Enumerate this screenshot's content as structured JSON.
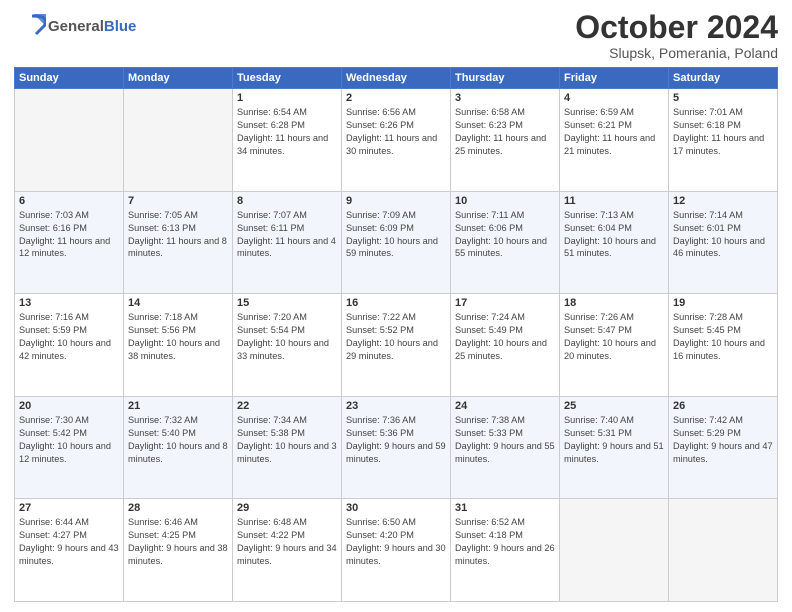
{
  "header": {
    "logo_general": "General",
    "logo_blue": "Blue",
    "month_title": "October 2024",
    "subtitle": "Slupsk, Pomerania, Poland"
  },
  "calendar": {
    "days_of_week": [
      "Sunday",
      "Monday",
      "Tuesday",
      "Wednesday",
      "Thursday",
      "Friday",
      "Saturday"
    ],
    "weeks": [
      {
        "cells": [
          {
            "day": "",
            "empty": true
          },
          {
            "day": "",
            "empty": true
          },
          {
            "day": "1",
            "sunrise": "6:54 AM",
            "sunset": "6:28 PM",
            "daylight": "11 hours and 34 minutes."
          },
          {
            "day": "2",
            "sunrise": "6:56 AM",
            "sunset": "6:26 PM",
            "daylight": "11 hours and 30 minutes."
          },
          {
            "day": "3",
            "sunrise": "6:58 AM",
            "sunset": "6:23 PM",
            "daylight": "11 hours and 25 minutes."
          },
          {
            "day": "4",
            "sunrise": "6:59 AM",
            "sunset": "6:21 PM",
            "daylight": "11 hours and 21 minutes."
          },
          {
            "day": "5",
            "sunrise": "7:01 AM",
            "sunset": "6:18 PM",
            "daylight": "11 hours and 17 minutes."
          }
        ]
      },
      {
        "cells": [
          {
            "day": "6",
            "sunrise": "7:03 AM",
            "sunset": "6:16 PM",
            "daylight": "11 hours and 12 minutes."
          },
          {
            "day": "7",
            "sunrise": "7:05 AM",
            "sunset": "6:13 PM",
            "daylight": "11 hours and 8 minutes."
          },
          {
            "day": "8",
            "sunrise": "7:07 AM",
            "sunset": "6:11 PM",
            "daylight": "11 hours and 4 minutes."
          },
          {
            "day": "9",
            "sunrise": "7:09 AM",
            "sunset": "6:09 PM",
            "daylight": "10 hours and 59 minutes."
          },
          {
            "day": "10",
            "sunrise": "7:11 AM",
            "sunset": "6:06 PM",
            "daylight": "10 hours and 55 minutes."
          },
          {
            "day": "11",
            "sunrise": "7:13 AM",
            "sunset": "6:04 PM",
            "daylight": "10 hours and 51 minutes."
          },
          {
            "day": "12",
            "sunrise": "7:14 AM",
            "sunset": "6:01 PM",
            "daylight": "10 hours and 46 minutes."
          }
        ]
      },
      {
        "cells": [
          {
            "day": "13",
            "sunrise": "7:16 AM",
            "sunset": "5:59 PM",
            "daylight": "10 hours and 42 minutes."
          },
          {
            "day": "14",
            "sunrise": "7:18 AM",
            "sunset": "5:56 PM",
            "daylight": "10 hours and 38 minutes."
          },
          {
            "day": "15",
            "sunrise": "7:20 AM",
            "sunset": "5:54 PM",
            "daylight": "10 hours and 33 minutes."
          },
          {
            "day": "16",
            "sunrise": "7:22 AM",
            "sunset": "5:52 PM",
            "daylight": "10 hours and 29 minutes."
          },
          {
            "day": "17",
            "sunrise": "7:24 AM",
            "sunset": "5:49 PM",
            "daylight": "10 hours and 25 minutes."
          },
          {
            "day": "18",
            "sunrise": "7:26 AM",
            "sunset": "5:47 PM",
            "daylight": "10 hours and 20 minutes."
          },
          {
            "day": "19",
            "sunrise": "7:28 AM",
            "sunset": "5:45 PM",
            "daylight": "10 hours and 16 minutes."
          }
        ]
      },
      {
        "cells": [
          {
            "day": "20",
            "sunrise": "7:30 AM",
            "sunset": "5:42 PM",
            "daylight": "10 hours and 12 minutes."
          },
          {
            "day": "21",
            "sunrise": "7:32 AM",
            "sunset": "5:40 PM",
            "daylight": "10 hours and 8 minutes."
          },
          {
            "day": "22",
            "sunrise": "7:34 AM",
            "sunset": "5:38 PM",
            "daylight": "10 hours and 3 minutes."
          },
          {
            "day": "23",
            "sunrise": "7:36 AM",
            "sunset": "5:36 PM",
            "daylight": "9 hours and 59 minutes."
          },
          {
            "day": "24",
            "sunrise": "7:38 AM",
            "sunset": "5:33 PM",
            "daylight": "9 hours and 55 minutes."
          },
          {
            "day": "25",
            "sunrise": "7:40 AM",
            "sunset": "5:31 PM",
            "daylight": "9 hours and 51 minutes."
          },
          {
            "day": "26",
            "sunrise": "7:42 AM",
            "sunset": "5:29 PM",
            "daylight": "9 hours and 47 minutes."
          }
        ]
      },
      {
        "cells": [
          {
            "day": "27",
            "sunrise": "6:44 AM",
            "sunset": "4:27 PM",
            "daylight": "9 hours and 43 minutes."
          },
          {
            "day": "28",
            "sunrise": "6:46 AM",
            "sunset": "4:25 PM",
            "daylight": "9 hours and 38 minutes."
          },
          {
            "day": "29",
            "sunrise": "6:48 AM",
            "sunset": "4:22 PM",
            "daylight": "9 hours and 34 minutes."
          },
          {
            "day": "30",
            "sunrise": "6:50 AM",
            "sunset": "4:20 PM",
            "daylight": "9 hours and 30 minutes."
          },
          {
            "day": "31",
            "sunrise": "6:52 AM",
            "sunset": "4:18 PM",
            "daylight": "9 hours and 26 minutes."
          },
          {
            "day": "",
            "empty": true
          },
          {
            "day": "",
            "empty": true
          }
        ]
      }
    ]
  }
}
